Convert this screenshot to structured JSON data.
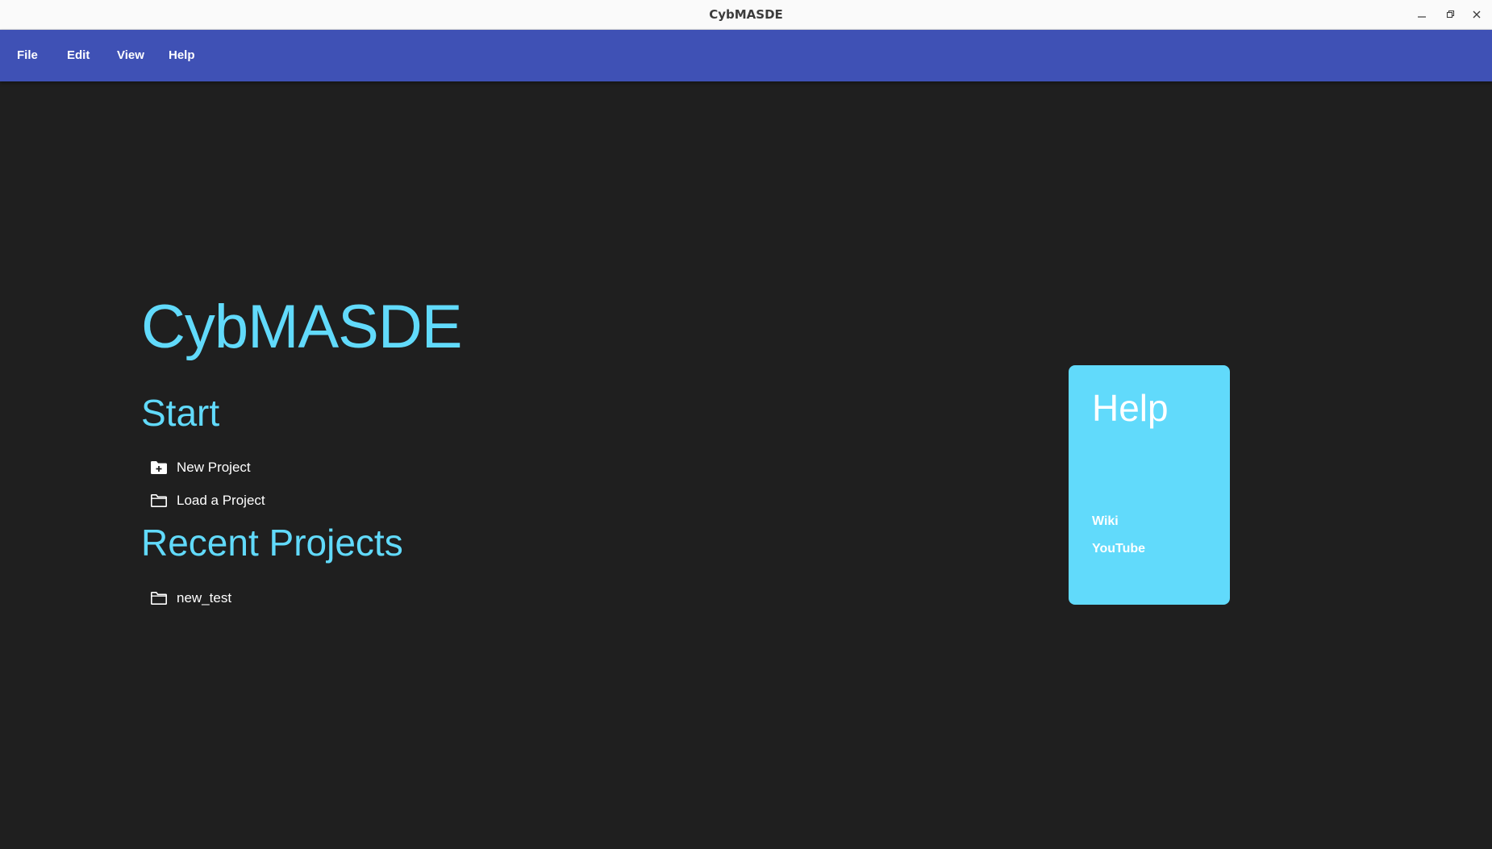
{
  "window": {
    "title": "CybMASDE",
    "controls": {
      "minimize_icon": "minimize-icon",
      "maximize_icon": "maximize-icon",
      "close_icon": "close-icon"
    }
  },
  "menubar": {
    "items": [
      {
        "label": "File"
      },
      {
        "label": "Edit"
      },
      {
        "label": "View"
      },
      {
        "label": "Help"
      }
    ],
    "color": "#3f51b5"
  },
  "main": {
    "app_title": "CybMASDE",
    "start": {
      "heading": "Start",
      "actions": [
        {
          "label": "New Project",
          "icon": "folder-plus-icon"
        },
        {
          "label": "Load a Project",
          "icon": "folder-icon"
        }
      ]
    },
    "recent": {
      "heading": "Recent Projects",
      "projects": [
        {
          "label": "new_test",
          "icon": "folder-icon"
        }
      ]
    }
  },
  "help_card": {
    "title": "Help",
    "links": [
      {
        "label": "Wiki"
      },
      {
        "label": "YouTube"
      }
    ],
    "color": "#61dafb"
  },
  "colors": {
    "accent": "#61dafb",
    "background": "#1f1f1f",
    "menubar": "#3f51b5"
  }
}
